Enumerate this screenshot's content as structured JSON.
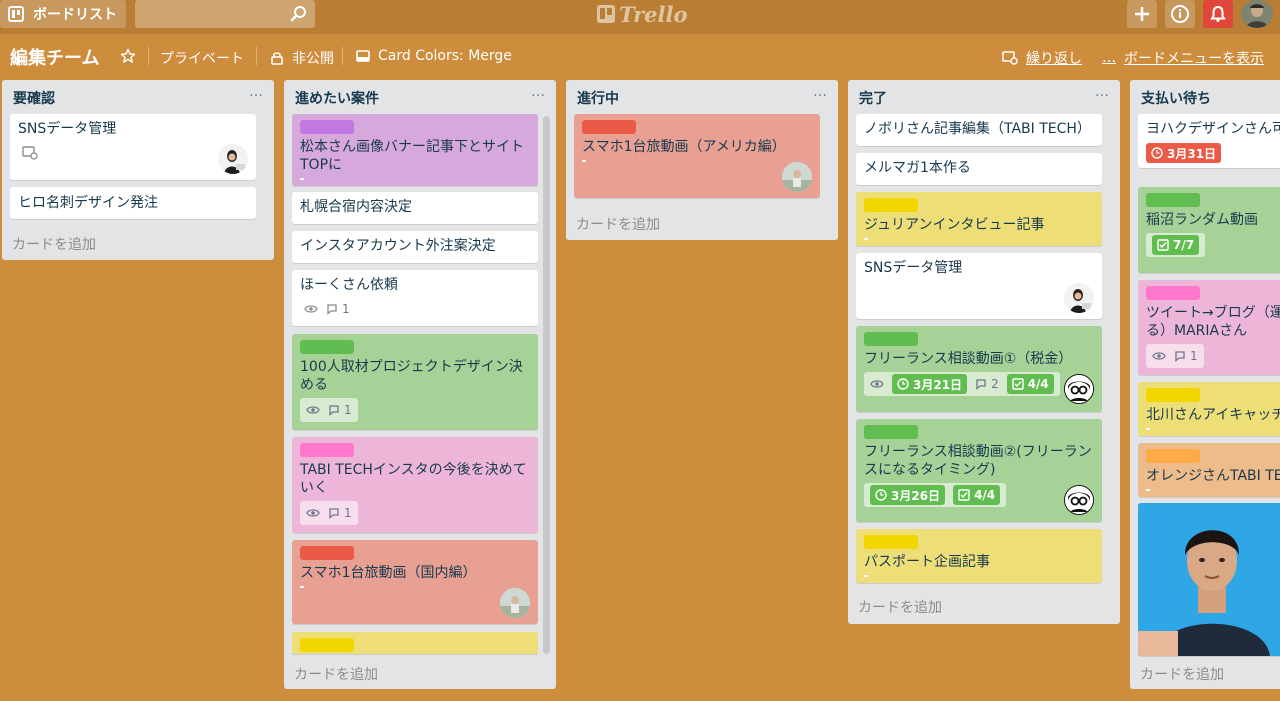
{
  "app": {
    "board_list_label": "ボードリスト",
    "search_placeholder": "",
    "logo_text": "Trello"
  },
  "board": {
    "title": "編集チーム",
    "privacy": "プライベート",
    "visibility": "非公開",
    "card_colors": "Card Colors: Merge",
    "repeat": "繰り返し",
    "menu": "ボードメニューを表示",
    "more": "…"
  },
  "colors": {
    "background": "#CE8D3D",
    "label_purple": "#C377E0",
    "label_green": "#61BD4F",
    "label_pink": "#FF78CB",
    "label_red": "#EB5A46",
    "label_yellow": "#F2D600",
    "label_orange": "#FFAB4A",
    "notification": "#E0473A"
  },
  "lists": [
    {
      "title": "要確認",
      "menu": "…",
      "add_card": "カードを追加",
      "cards": [
        {
          "text": "SNSデータ管理",
          "icon": "card-recurring-icon",
          "member": "woman-avatar"
        },
        {
          "text": "ヒロ名刺デザイン発注"
        }
      ]
    },
    {
      "title": "進めたい案件",
      "menu": "…",
      "add_card": "カードを追加",
      "cards": [
        {
          "text": "松本さん画像バナー記事下とサイトTOPに",
          "label": "purple",
          "color": "purple"
        },
        {
          "text": "札幌合宿内容決定"
        },
        {
          "text": "インスタアカウント外注案決定"
        },
        {
          "text": "ほーくさん依頼",
          "comments": "1",
          "watch": "eye-icon"
        },
        {
          "text": "100人取材プロジェクトデザイン決める",
          "label": "green",
          "color": "green",
          "comments": "1"
        },
        {
          "text": "TABI TECHインスタの今後を決めていく",
          "label": "pink",
          "color": "pink",
          "comments": "1"
        },
        {
          "text": "スマホ1台旅動画（国内編）",
          "label": "red",
          "color": "red",
          "member": "photo-avatar"
        },
        {
          "text": "",
          "label": "yellow",
          "color": "yellow"
        }
      ]
    },
    {
      "title": "進行中",
      "menu": "…",
      "add_card": "カードを追加",
      "cards": [
        {
          "text": "スマホ1台旅動画（アメリカ編）",
          "label": "red",
          "color": "red",
          "member": "photo-avatar"
        }
      ]
    },
    {
      "title": "完了",
      "menu": "…",
      "add_card": "カードを追加",
      "cards": [
        {
          "text": "ノボリさん記事編集（TABI TECH）"
        },
        {
          "text": "メルマガ1本作る"
        },
        {
          "text": "ジュリアンインタビュー記事",
          "label": "yellow",
          "color": "yellow"
        },
        {
          "text": "SNSデータ管理",
          "member": "woman-avatar"
        },
        {
          "text": "フリーランス相談動画①（税金）",
          "label": "green",
          "color": "green",
          "due": "3月21日",
          "comments": "2",
          "checklist": "4/4",
          "member": "glasses-avatar"
        },
        {
          "text": "フリーランス相談動画②(フリーランスになるタイミング)",
          "label": "green",
          "color": "green",
          "due": "3月26日",
          "checklist": "4/4",
          "member": "glasses-avatar"
        },
        {
          "text": "パスポート企画記事",
          "label": "yellow",
          "color": "yellow"
        }
      ]
    },
    {
      "title": "支払い待ち",
      "menu": "…",
      "add_card": "カードを追加",
      "cards": [
        {
          "text": "ヨハクデザインさん可",
          "due": "3月31日"
        },
        {
          "text": "稲沼ランダム動画",
          "label": "green",
          "color": "green",
          "checklist": "7/7"
        },
        {
          "text": "ツイート→ブログ（運る）MARIAさん",
          "label": "pink",
          "color": "pink",
          "comments": "1"
        },
        {
          "text": "北川さんアイキャッチ",
          "label": "yellow",
          "color": "yellow"
        },
        {
          "text": "オレンジさんTABI TE",
          "label": "orange",
          "color": "orange"
        },
        {
          "text": "",
          "cover": "man-photo"
        }
      ]
    }
  ]
}
